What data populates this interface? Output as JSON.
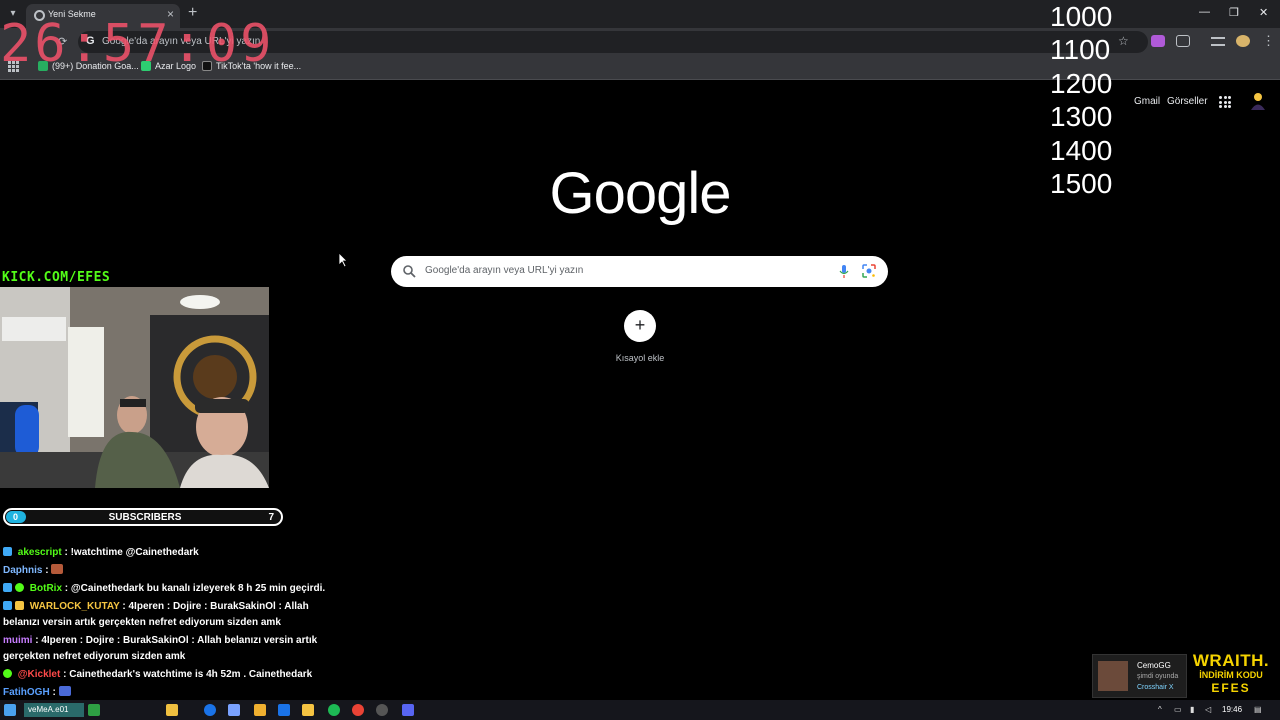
{
  "browser": {
    "tab_title": "Yeni Sekme",
    "omnibox_text": "Google'da arayın veya URL'yi yazın",
    "bookmarks": [
      {
        "label": "(99+) Donation Goa...",
        "color": "#27ae60"
      },
      {
        "label": "Azar Logo",
        "color": "#2ecc71"
      },
      {
        "label": "TikTok'ta 'how it fee...",
        "color": "#111111"
      }
    ]
  },
  "overlay": {
    "clock": "26:57:09",
    "clock_color": "#f0526a",
    "numbers": [
      "1000",
      "1100",
      "1200",
      "1300",
      "1400",
      "1500"
    ],
    "kick_url": "KICK.COM/EFES",
    "kick_color": "#53fc18"
  },
  "google": {
    "logo": "Google",
    "links": {
      "gmail": "Gmail",
      "images": "Görseller"
    },
    "search_placeholder": "Google'da arayın veya URL'yi yazın",
    "shortcut_label": "Kısayol ekle"
  },
  "subscribers": {
    "label": "SUBSCRIBERS",
    "current": "0",
    "goal": "7",
    "progress": 0
  },
  "chat": [
    {
      "user": "akescript",
      "user_color": "#53fc18",
      "text": "!watchtime @Cainethedark"
    },
    {
      "user": "Daphnis",
      "user_color": "#7fb8ff",
      "text": ""
    },
    {
      "user": "BotRix",
      "user_color": "#53fc18",
      "text": "@Cainethedark bu kanalı izleyerek 8 h 25 min geçirdi."
    },
    {
      "user": "WARLOCK_KUTAY",
      "user_color": "#f5c542",
      "text": "4Iperen : Dojire : BurakSakinOl : Allah belanızı versin artık gerçekten nefret ediyorum sizden amk"
    },
    {
      "user": "muimi",
      "user_color": "#c77dff",
      "text": "4Iperen : Dojire : BurakSakinOl : Allah belanızı versin artık gerçekten nefret ediyorum sizden amk"
    },
    {
      "user": "@Kicklet",
      "user_color": "#ff4a4a",
      "text": "Cainethedark's watchtime is 4h 52m . Cainethedark"
    },
    {
      "user": "FatihOGH",
      "user_color": "#5aa0ff",
      "text": ""
    }
  ],
  "notification": {
    "name": "CemoGG",
    "status": "şimdi oyunda",
    "game": "Crosshair X"
  },
  "sponsor": {
    "brand": "WRAITH.",
    "line": "İNDİRİM KODU",
    "code": "EFES"
  },
  "taskbar": {
    "search_text": "veMeA.e01",
    "time": "19:46"
  }
}
